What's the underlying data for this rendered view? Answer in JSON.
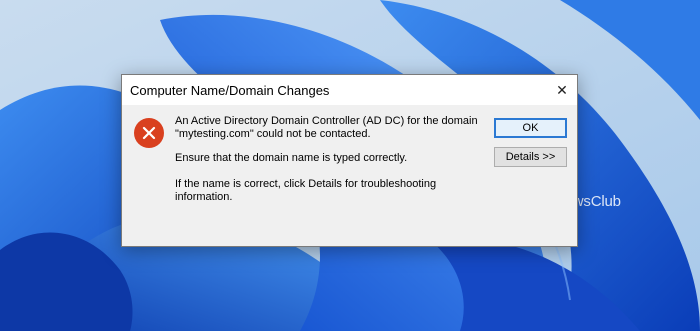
{
  "dialog": {
    "title": "Computer Name/Domain Changes",
    "close_glyph": "✕",
    "message_line1": "An Active Directory Domain Controller (AD DC) for the domain",
    "message_line2": "\"mytesting.com\" could not be contacted.",
    "message_line3": "Ensure that the domain name is typed correctly.",
    "message_line4": "If the name is correct, click Details for troubleshooting information.",
    "ok_label": "OK",
    "details_label": "Details >>",
    "icon": "error-icon"
  },
  "watermark": {
    "text": "TheWindowsClub"
  },
  "colors": {
    "error_red": "#d9401f",
    "focus_blue": "#2b79d3",
    "wallpaper_blue": "#1a5fd6"
  }
}
